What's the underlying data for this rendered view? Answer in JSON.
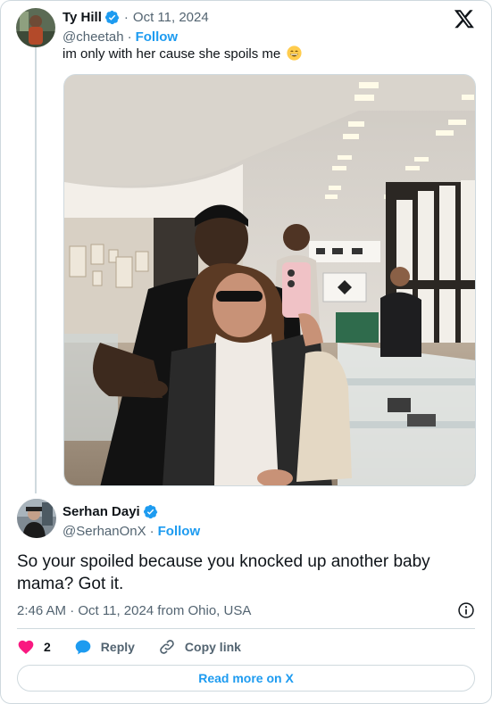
{
  "tweet": {
    "author_name": "Ty Hill",
    "handle": "@cheetah",
    "date": "Oct 11, 2024",
    "follow_label": "Follow",
    "text": "im only with her cause she spoils me",
    "emoji": "grinning-face-emoji",
    "verified": true
  },
  "reply": {
    "author_name": "Serhan Dayi",
    "handle": "@SerhanOnX",
    "follow_label": "Follow",
    "verified": true,
    "text": "So your spoiled because you knocked up another baby mama? Got it.",
    "timestamp": "2:46 AM · Oct 11, 2024 from Ohio, USA"
  },
  "actions": {
    "like_count": "2",
    "reply_label": "Reply",
    "copy_link_label": "Copy link"
  },
  "footer": {
    "read_more_label": "Read more on X"
  },
  "colors": {
    "accent": "#1d9bf0",
    "like": "#f91880",
    "muted": "#536471",
    "border": "#cfd9de"
  }
}
